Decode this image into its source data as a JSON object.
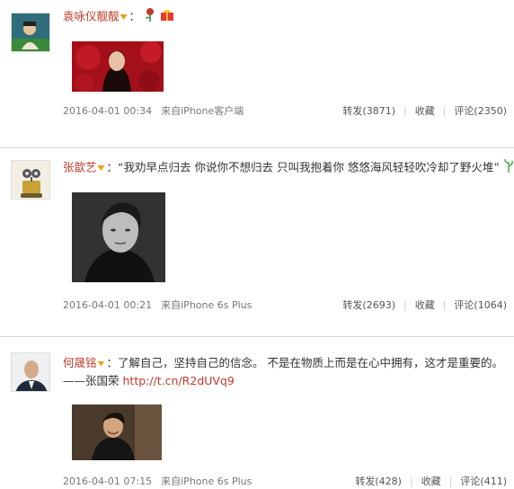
{
  "posts": [
    {
      "author": "袁咏仪靓靓",
      "text_prefix": "：",
      "text": "",
      "link": "",
      "time": "2016-04-01 00:34",
      "source": "来自iPhone客户端",
      "repost": "转发(3871)",
      "favorite": "收藏",
      "comment": "评论(2350)"
    },
    {
      "author": "张歆艺",
      "text_prefix": "：",
      "text": "“我劝早点归去 你说你不想归去 只叫我抱着你 悠悠海风轻轻吹冷却了野火堆”",
      "link": "",
      "time": "2016-04-01 00:21",
      "source": "来自iPhone 6s Plus",
      "repost": "转发(2693)",
      "favorite": "收藏",
      "comment": "评论(1064)"
    },
    {
      "author": "何晟铭",
      "text_prefix": "：",
      "text": "了解自己，坚持自己的信念。 不是在物质上而是在心中拥有，这才是重要的。",
      "text2": "——张国荣",
      "link": "http://t.cn/R2dUVq9",
      "time": "2016-04-01 07:15",
      "source": "来自iPhone 6s Plus",
      "repost": "转发(428)",
      "favorite": "收藏",
      "comment": "评论(411)"
    }
  ],
  "colors": {
    "author": "#c0392b",
    "meta": "#777777",
    "divider": "#d8d8d8"
  },
  "icons": [
    "rose-emoji-icon",
    "gift-emoji-icon",
    "plant-emoji-icon",
    "verified-v-icon"
  ]
}
